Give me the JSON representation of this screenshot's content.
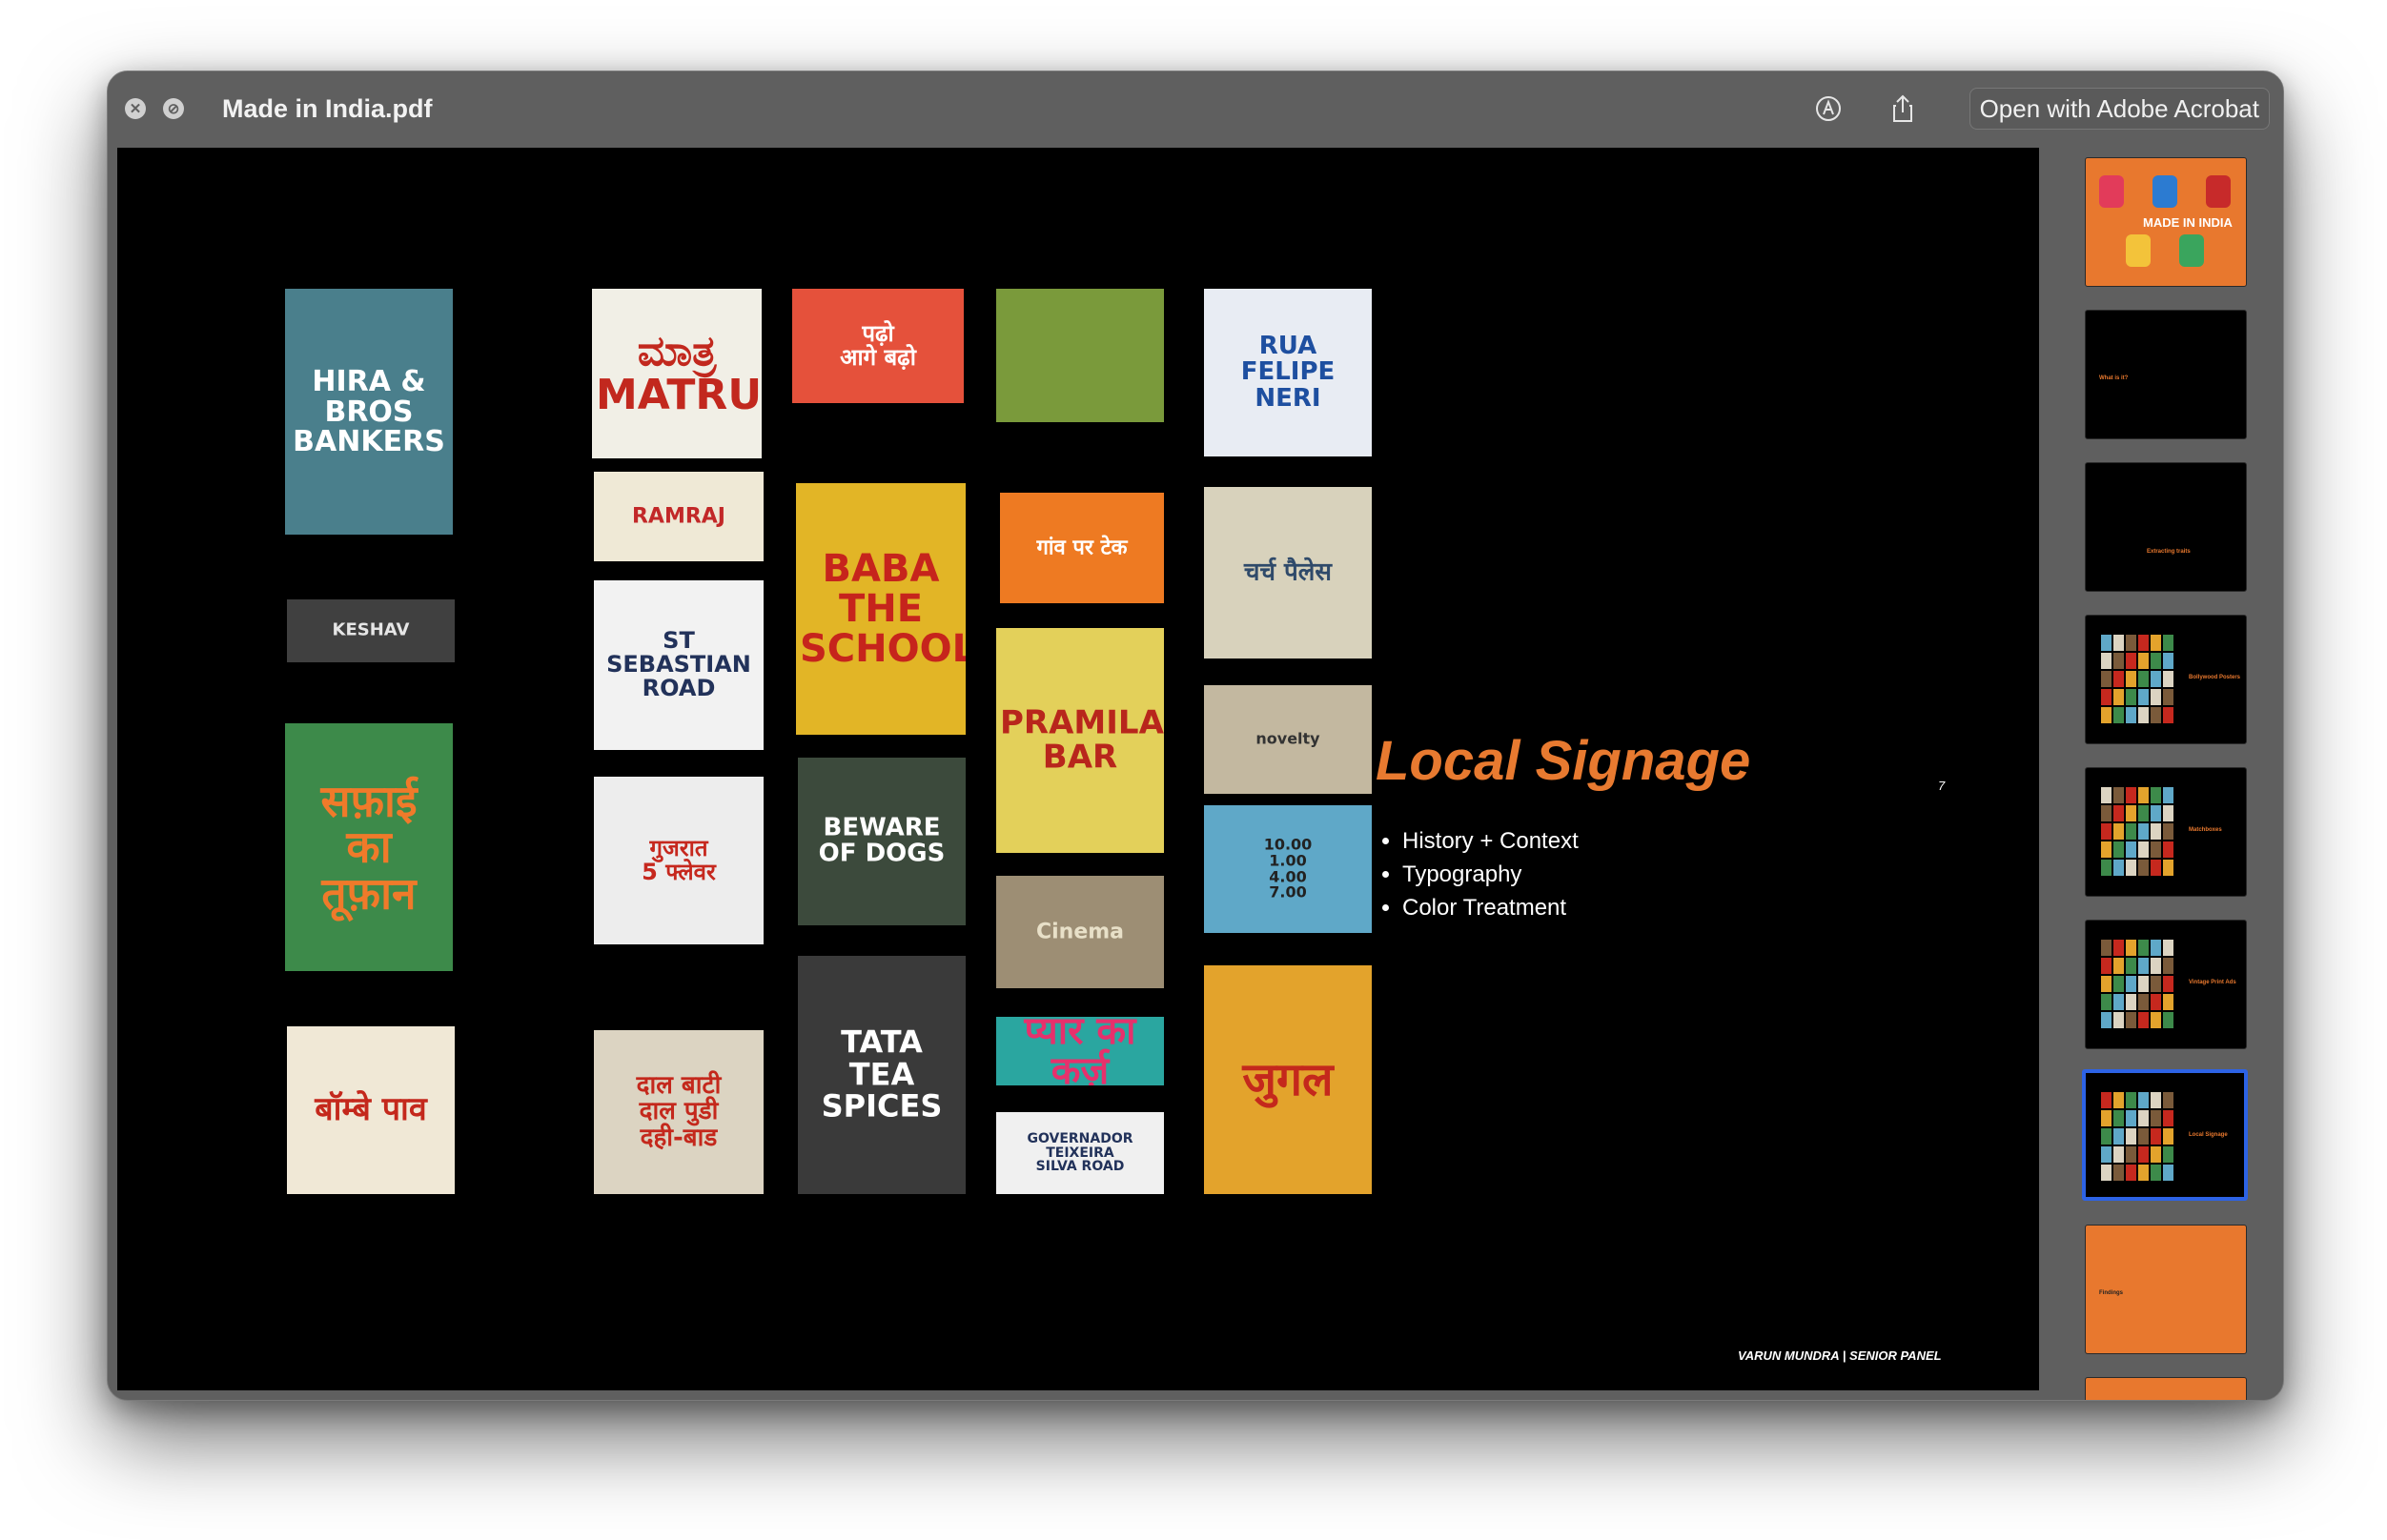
{
  "window": {
    "title": "Made in India.pdf",
    "open_with_label": "Open with Adobe Acrobat",
    "icons": [
      "close-icon",
      "disabled-icon",
      "markup-icon",
      "share-icon"
    ]
  },
  "slide": {
    "heading": "Local Signage",
    "page_number": "7",
    "bullets": [
      "History + Context",
      "Typography",
      "Color Treatment"
    ],
    "footer": "VARUN MUNDRA | SENIOR PANEL",
    "heading_color": "#e87a30"
  },
  "photo_tiles": [
    {
      "text": "HIRA & BROS\nBANKERS",
      "bg": "#4a7f8c",
      "fg": "#ffffff"
    },
    {
      "text": "ಮಾತ್ರ\nMATRU",
      "bg": "#f1efe6",
      "fg": "#c2281e"
    },
    {
      "text": "पढ़ो\nआगे बढ़ो",
      "bg": "#e5513b",
      "fg": "#ffffff"
    },
    {
      "text": "",
      "bg": "#7a9a3b",
      "fg": "#ffe14a"
    },
    {
      "text": "RUA\nFELIPE NERI",
      "bg": "#e8ecf3",
      "fg": "#1e4fa0"
    },
    {
      "text": "RAMRAJ",
      "bg": "#efe9d6",
      "fg": "#c22828"
    },
    {
      "text": "BABA\nTHE SCHOOL",
      "bg": "#e2b526",
      "fg": "#c6241c"
    },
    {
      "text": "गांव पर टेक",
      "bg": "#ee7a22",
      "fg": "#ffffff"
    },
    {
      "text": "चर्च पैलेस",
      "bg": "#d8d2bc",
      "fg": "#2f4a6a"
    },
    {
      "text": "KESHAV",
      "bg": "#404040",
      "fg": "#e6e6e6"
    },
    {
      "text": "ST\nSEBASTIAN\nROAD",
      "bg": "#f2f2f2",
      "fg": "#22325a"
    },
    {
      "text": "PRAMILA\nBAR",
      "bg": "#e3d05a",
      "fg": "#b8261c"
    },
    {
      "text": "novelty",
      "bg": "#c3b8a0",
      "fg": "#333333"
    },
    {
      "text": "सफ़ाई\nका\nतूफ़ान",
      "bg": "#3d8a4a",
      "fg": "#f07a2a"
    },
    {
      "text": "BEWARE\nOF DOGS",
      "bg": "#3c4a3c",
      "fg": "#ffffff"
    },
    {
      "text": "10.00\n1.00\n4.00\n7.00",
      "bg": "#5fa8c8",
      "fg": "#222222"
    },
    {
      "text": "गुजरात\n5 फ्लेवर",
      "bg": "#ededed",
      "fg": "#c6281e"
    },
    {
      "text": "Cinema",
      "bg": "#9d8e74",
      "fg": "#e8e0c8"
    },
    {
      "text": "TATA\nTEA SPICES",
      "bg": "#3a3a3a",
      "fg": "#ffffff"
    },
    {
      "text": "प्यार का कर्ज़",
      "bg": "#2aa6a0",
      "fg": "#e7306c"
    },
    {
      "text": "जुगल",
      "bg": "#e3a32c",
      "fg": "#c4281c"
    },
    {
      "text": "बॉम्बे पाव",
      "bg": "#f0e8d6",
      "fg": "#c4281c"
    },
    {
      "text": "दाल बाटी\nदाल पुडी\nदही-बाड",
      "bg": "#dcd4c2",
      "fg": "#c4281c"
    },
    {
      "text": "GOVERNADOR\nTEIXEIRA\nSILVA ROAD",
      "bg": "#f0f0f0",
      "fg": "#22325a"
    }
  ],
  "thumbnails": [
    {
      "label": "MADE IN INDIA",
      "bg": "#e8782e",
      "fg": "#ffffff"
    },
    {
      "label": "What is it?",
      "bg": "#000000",
      "fg": "#e8782e"
    },
    {
      "label": "Extracting traits",
      "bg": "#000000",
      "fg": "#e8782e"
    },
    {
      "label": "Bollywood Posters",
      "bg": "#000000",
      "fg": "#e8782e"
    },
    {
      "label": "Matchboxes",
      "bg": "#000000",
      "fg": "#e8782e"
    },
    {
      "label": "Vintage Print Ads",
      "bg": "#000000",
      "fg": "#e8782e"
    },
    {
      "label": "Local Signage",
      "bg": "#000000",
      "fg": "#e8782e"
    },
    {
      "label": "Findings",
      "bg": "#e8782e",
      "fg": "#222222"
    },
    {
      "label": "",
      "bg": "#e8782e",
      "fg": "#222222"
    }
  ],
  "selected_thumbnail": "Local Signage"
}
